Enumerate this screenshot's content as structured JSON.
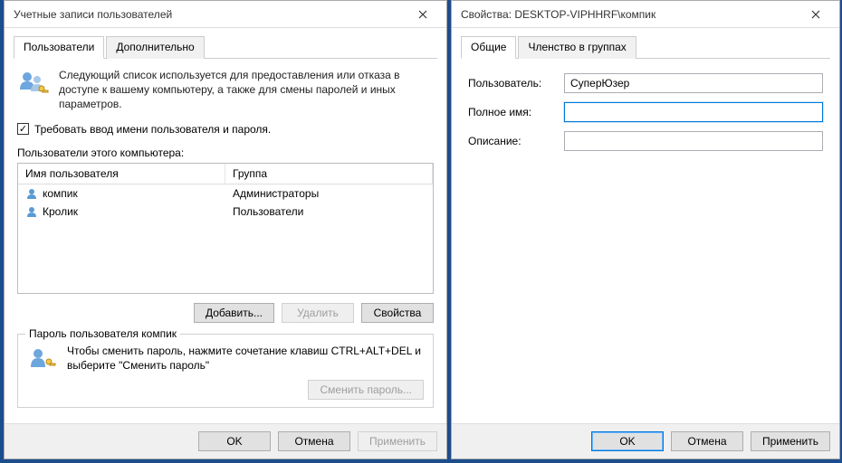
{
  "left": {
    "title": "Учетные записи пользователей",
    "tabs": {
      "users": "Пользователи",
      "advanced": "Дополнительно"
    },
    "intro": "Следующий список используется для предоставления или отказа в доступе к вашему компьютеру, а также для смены паролей и иных параметров.",
    "require_login": "Требовать ввод имени пользователя и пароля.",
    "users_of_computer": "Пользователи этого компьютера:",
    "cols": {
      "name": "Имя пользователя",
      "group": "Группа"
    },
    "rows": [
      {
        "name": "компик",
        "group": "Администраторы"
      },
      {
        "name": "Кролик",
        "group": "Пользователи"
      }
    ],
    "btns": {
      "add": "Добавить...",
      "remove": "Удалить",
      "props": "Свойства"
    },
    "pwbox": {
      "legend": "Пароль пользователя компик",
      "text": "Чтобы сменить пароль, нажмите сочетание клавиш CTRL+ALT+DEL и выберите \"Сменить пароль\"",
      "change": "Сменить пароль..."
    },
    "footer": {
      "ok": "OK",
      "cancel": "Отмена",
      "apply": "Применить"
    }
  },
  "right": {
    "title": "Свойства: DESKTOP-VIPHHRF\\компик",
    "tabs": {
      "general": "Общие",
      "membership": "Членство в группах"
    },
    "fields": {
      "user_label": "Пользователь:",
      "user_value": "СуперЮзер",
      "fullname_label": "Полное имя:",
      "fullname_value": "",
      "desc_label": "Описание:",
      "desc_value": ""
    },
    "footer": {
      "ok": "OK",
      "cancel": "Отмена",
      "apply": "Применить"
    }
  }
}
